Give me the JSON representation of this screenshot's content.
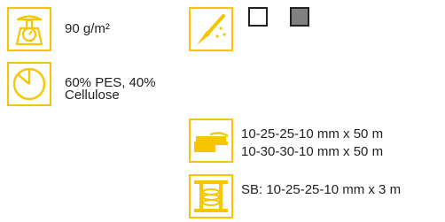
{
  "weight": {
    "icon": "scale-icon",
    "text": "90 g/m²"
  },
  "composition": {
    "icon": "pie-chart-icon",
    "text_line1": "60% PES, 40%",
    "text_line2": "Cellulose"
  },
  "paint": {
    "icon": "brush-icon"
  },
  "colors": [
    {
      "name": "white",
      "hex": "#ffffff"
    },
    {
      "name": "grey",
      "hex": "#808080"
    }
  ],
  "tape": {
    "icon": "tape-roll-icon",
    "line1": "10-25-25-10 mm x 50 m",
    "line2": "10-30-30-10 mm x 50 m"
  },
  "spool": {
    "icon": "spool-icon",
    "text": "SB: 10-25-25-10 mm x 3 m"
  },
  "accent_color": "#f7c600"
}
